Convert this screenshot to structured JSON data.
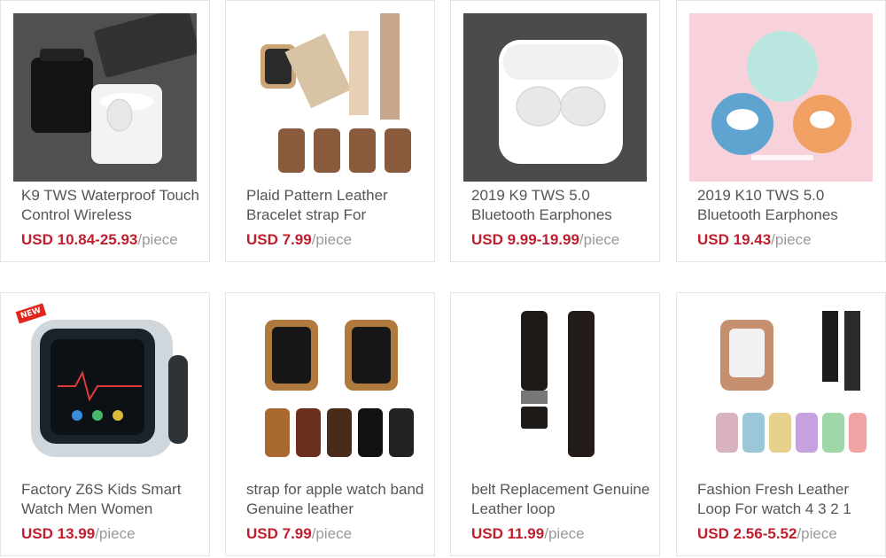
{
  "products": [
    {
      "title": "K9 TWS Waterproof Touch Control Wireless",
      "price": "USD 10.84-25.93",
      "unit": "/piece",
      "image_icon": "earbuds-icon"
    },
    {
      "title": "Plaid Pattern Leather Bracelet strap For",
      "price": "USD 7.99",
      "unit": "/piece",
      "image_icon": "watch-strap-icon"
    },
    {
      "title": "2019 K9 TWS 5.0 Bluetooth Earphones",
      "price": "USD 9.99-19.99",
      "unit": "/piece",
      "image_icon": "earbuds-icon"
    },
    {
      "title": "2019 K10 TWS 5.0 Bluetooth Earphones",
      "price": "USD 19.43",
      "unit": "/piece",
      "image_icon": "earbuds-icon"
    },
    {
      "title": "Factory Z6S Kids Smart Watch Men Women",
      "price": "USD 13.99",
      "unit": "/piece",
      "image_icon": "smartwatch-icon"
    },
    {
      "title": "strap for apple watch band Genuine leather",
      "price": "USD 7.99",
      "unit": "/piece",
      "image_icon": "watch-strap-icon"
    },
    {
      "title": "belt Replacement Genuine Leather loop",
      "price": "USD 11.99",
      "unit": "/piece",
      "image_icon": "watch-strap-icon"
    },
    {
      "title": "Fashion Fresh Leather Loop For watch 4 3 2 1",
      "price": "USD 2.56-5.52",
      "unit": "/piece",
      "image_icon": "watch-strap-icon"
    }
  ],
  "badge": "NEW"
}
